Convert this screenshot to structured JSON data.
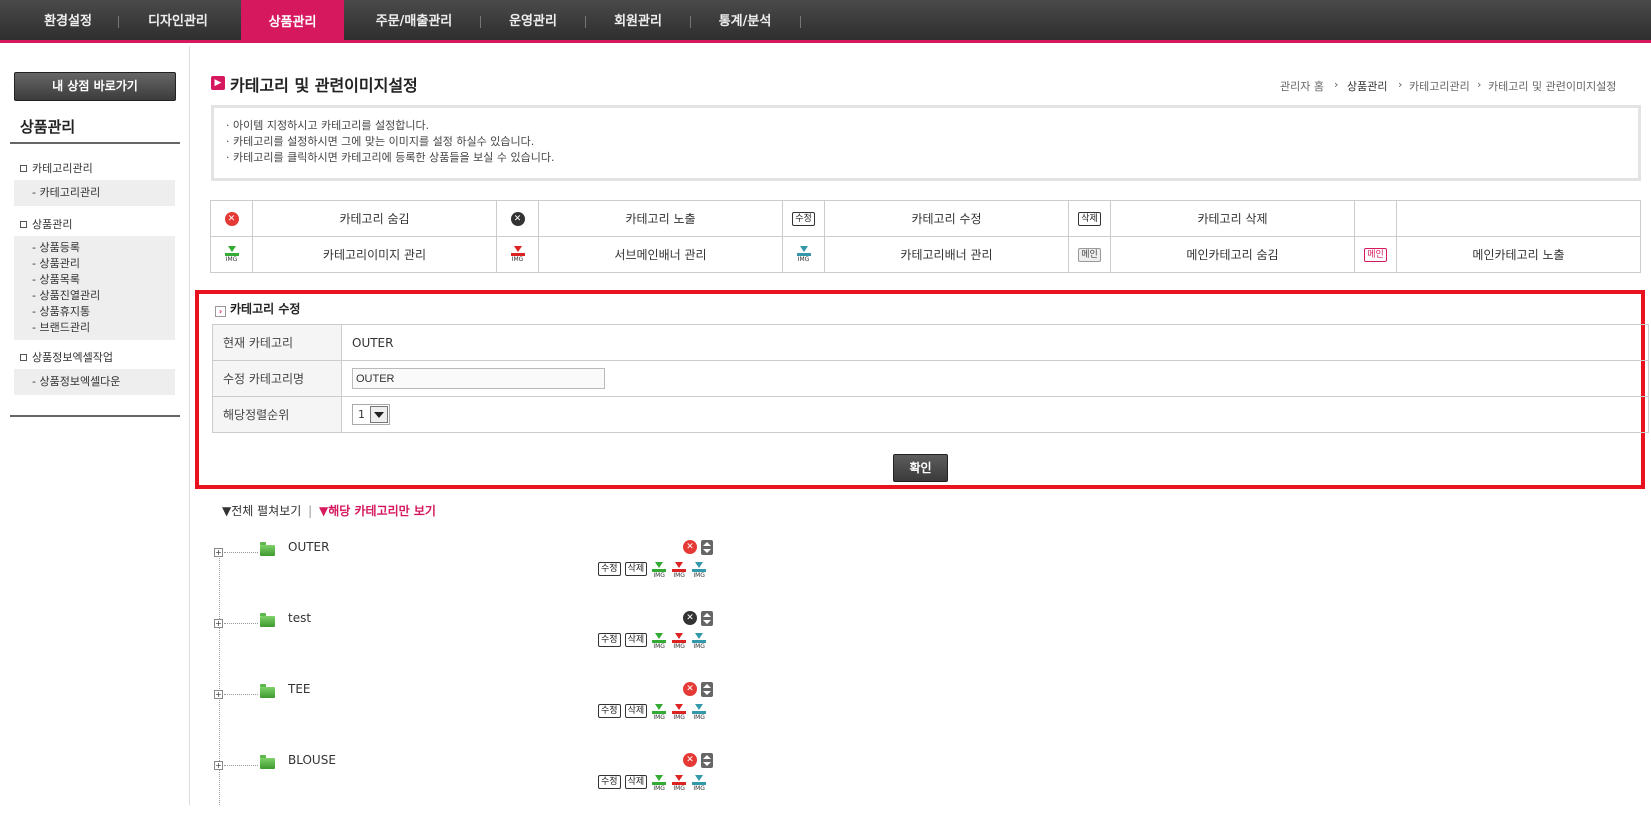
{
  "nav": {
    "items": [
      {
        "label": "환경설정"
      },
      {
        "label": "디자인관리"
      },
      {
        "label": "상품관리",
        "active": true
      },
      {
        "label": "주문/매출관리"
      },
      {
        "label": "운영관리"
      },
      {
        "label": "회원관리"
      },
      {
        "label": "통계/분석"
      }
    ],
    "accent_color": "#d6195f"
  },
  "sidebar": {
    "store_button": "내 상점 바로가기",
    "title": "상품관리",
    "groups": [
      {
        "label": "카테고리관리",
        "subs": [
          "- 카테고리관리"
        ]
      },
      {
        "label": "상품관리",
        "subs": [
          "- 상품등록",
          "- 상품관리",
          "- 상품목록",
          "- 상품진열관리",
          "- 상품휴지통",
          "- 브랜드관리"
        ]
      },
      {
        "label": "상품정보엑셀작업",
        "subs": [
          "- 상품정보엑셀다운"
        ]
      }
    ]
  },
  "page": {
    "title": "카테고리 및 관련이미지설정",
    "breadcrumb": [
      "관리자 홈",
      "상품관리",
      "카테고리관리",
      "카테고리 및 관련이미지설정"
    ],
    "info_lines": [
      "· 아이템 지정하시고 카테고리를 설정합니다.",
      "· 카테고리를 설정하시면 그에 맞는 이미지를 설정 하실수 있습니다.",
      "· 카테고리를 클릭하시면 카테고리에 등록한 상품들을 보실 수 있습니다."
    ]
  },
  "legend": {
    "row1": [
      "카테고리 숨김",
      "카테고리 노출",
      "카테고리 수정",
      "카테고리 삭제"
    ],
    "row2": [
      "카테고리이미지 관리",
      "서브메인배너 관리",
      "카테고리배너 관리",
      "메인카테고리 숨김",
      "메인카테고리 노출"
    ],
    "icon_labels": {
      "edit": "수정",
      "delete": "삭제",
      "main": "메인",
      "img": "IMG"
    }
  },
  "edit_form": {
    "title": "카테고리 수정",
    "current_label": "현재 카테고리",
    "current_value": "OUTER",
    "name_label": "수정 카테고리명",
    "name_value": "OUTER",
    "order_label": "해당정렬순위",
    "order_value": "1",
    "confirm": "확인"
  },
  "view_toggle": {
    "all": "▼전체 펼쳐보기",
    "divider": "|",
    "only": "▼해당 카테고리만 보기"
  },
  "tree": [
    {
      "name": "OUTER",
      "visible": false
    },
    {
      "name": "test",
      "visible": true
    },
    {
      "name": "TEE",
      "visible": false
    },
    {
      "name": "BLOUSE",
      "visible": false
    }
  ]
}
